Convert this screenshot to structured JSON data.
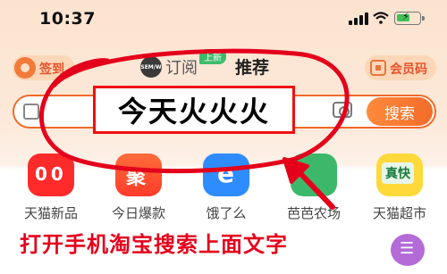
{
  "status_bar": {
    "time": "10:37"
  },
  "header": {
    "left_chip": "签到",
    "tab_subscribe": "订阅",
    "tab_subscribe_badge": "上新",
    "tab_subscribe_icon_text": "SEM/W",
    "tab_recommend": "推荐",
    "member_code": "会员码"
  },
  "search": {
    "query": "今天火火火",
    "button_label": "搜索"
  },
  "quick_entries": [
    {
      "label": "天猫新品",
      "icon": "tmall-new-icon"
    },
    {
      "label": "今日爆款",
      "icon": "hot-deal-icon"
    },
    {
      "label": "饿了么",
      "icon": "eleme-icon"
    },
    {
      "label": "芭芭农场",
      "icon": "farm-icon"
    },
    {
      "label": "天猫超市",
      "icon": "tmall-supermarket-icon"
    }
  ],
  "annotation": {
    "caption": "打开手机淘宝搜索上面文字",
    "color": "#e4001b"
  }
}
